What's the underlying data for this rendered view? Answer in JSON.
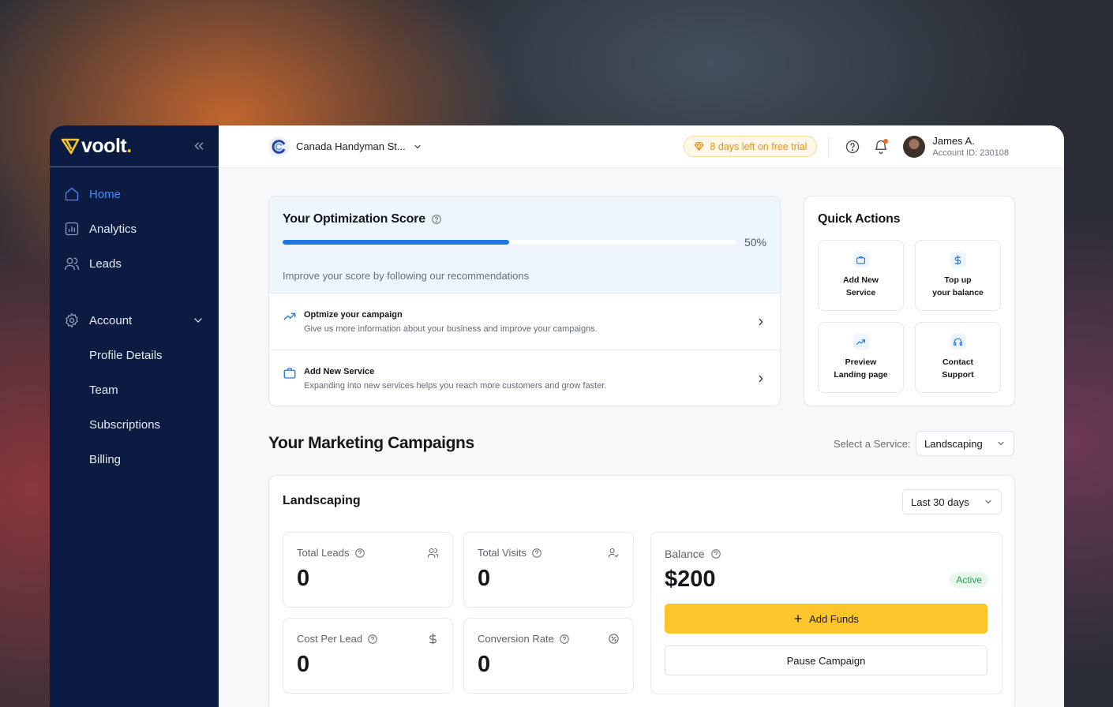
{
  "brand": {
    "name": "voolt",
    "dot": "."
  },
  "sidebar": {
    "items": [
      {
        "label": "Home",
        "icon": "home-icon",
        "active": true
      },
      {
        "label": "Analytics",
        "icon": "analytics-icon"
      },
      {
        "label": "Leads",
        "icon": "users-icon"
      }
    ],
    "account": {
      "label": "Account",
      "icon": "gear-icon",
      "children": [
        "Profile Details",
        "Team",
        "Subscriptions",
        "Billing"
      ]
    }
  },
  "topbar": {
    "business_name": "Canada Handyman St...",
    "trial_text": "8 days left on free trial",
    "user": {
      "name": "James A.",
      "account_id": "Account ID: 230108"
    }
  },
  "optimization": {
    "title": "Your Optimization Score",
    "progress_percent": 50,
    "percent_label": "50%",
    "subtitle": "Improve your score by following our recommendations",
    "recommendations": [
      {
        "title": "Optmize your campaign",
        "desc": "Give us more information about your business and improve your campaigns."
      },
      {
        "title": "Add New Service",
        "desc": "Expanding into new services helps you reach more customers and grow faster."
      }
    ]
  },
  "quick_actions": {
    "title": "Quick Actions",
    "items": [
      {
        "line1": "Add New",
        "line2": "Service"
      },
      {
        "line1": "Top up",
        "line2": "your balance"
      },
      {
        "line1": "Preview",
        "line2": "Landing page"
      },
      {
        "line1": "Contact",
        "line2": "Support"
      }
    ]
  },
  "campaigns": {
    "title": "Your Marketing Campaigns",
    "service_label": "Select a Service:",
    "service_selected": "Landscaping",
    "card_title": "Landscaping",
    "period_selected": "Last 30 days",
    "stats": [
      {
        "label": "Total Leads",
        "value": "0"
      },
      {
        "label": "Total Visits",
        "value": "0"
      },
      {
        "label": "Cost Per Lead",
        "value": "0"
      },
      {
        "label": "Conversion Rate",
        "value": "0"
      }
    ],
    "balance": {
      "label": "Balance",
      "value": "$200",
      "status": "Active",
      "add_funds": "Add Funds",
      "pause": "Pause Campaign"
    }
  },
  "colors": {
    "sidebar_bg": "#0c1b42",
    "accent": "#1d76e5",
    "cta": "#fcc52c",
    "trial": "#e6921b",
    "active_status": "#2c9a55"
  }
}
